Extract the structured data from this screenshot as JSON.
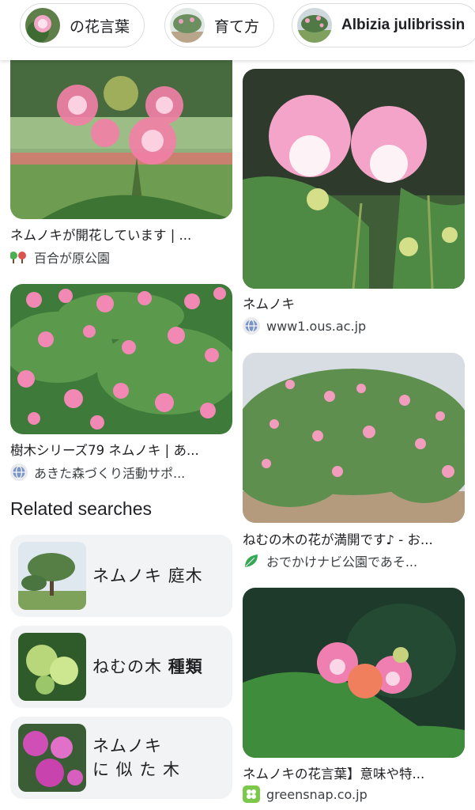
{
  "chips": [
    {
      "label": "の花言葉",
      "icon": "mimosa-flower-thumb"
    },
    {
      "label": "育て方",
      "icon": "tree-thumb"
    },
    {
      "label": "Albizia julibrissin",
      "icon": "tree-field-thumb"
    }
  ],
  "results": [
    {
      "title": "ネムノキが開花しています | ...",
      "source": "百合が原公園",
      "favicon": "park-favicon"
    },
    {
      "title": "ネムノキ",
      "source": "www1.ous.ac.jp",
      "favicon": "globe-favicon"
    },
    {
      "title": "樹木シリーズ79 ネムノキ | あ...",
      "source": "あきた森づくり活動サポ...",
      "favicon": "globe-favicon"
    },
    {
      "title": "ねむの木の花が満開です♪ - お...",
      "source": "おでかけナビ公園であそ...",
      "favicon": "leaf-favicon"
    },
    {
      "title": "ネムノキの花言葉】意味や特...",
      "source": "greensnap.co.jp",
      "favicon": "greensnap-favicon"
    }
  ],
  "related": {
    "heading": "Related searches",
    "items": [
      {
        "line1": "ネムノキ 庭木",
        "line2": "",
        "bold": ""
      },
      {
        "line1": "ねむの木 ",
        "line2": "",
        "bold": "種類"
      },
      {
        "line1": "ネムノキ",
        "line2": "に 似 た 木",
        "bold": ""
      }
    ]
  },
  "colors": {
    "chip_border": "#dadce0",
    "related_bg": "#f1f3f4",
    "flower_pink": "#f27fb0",
    "foliage_green": "#3f7d3a"
  }
}
